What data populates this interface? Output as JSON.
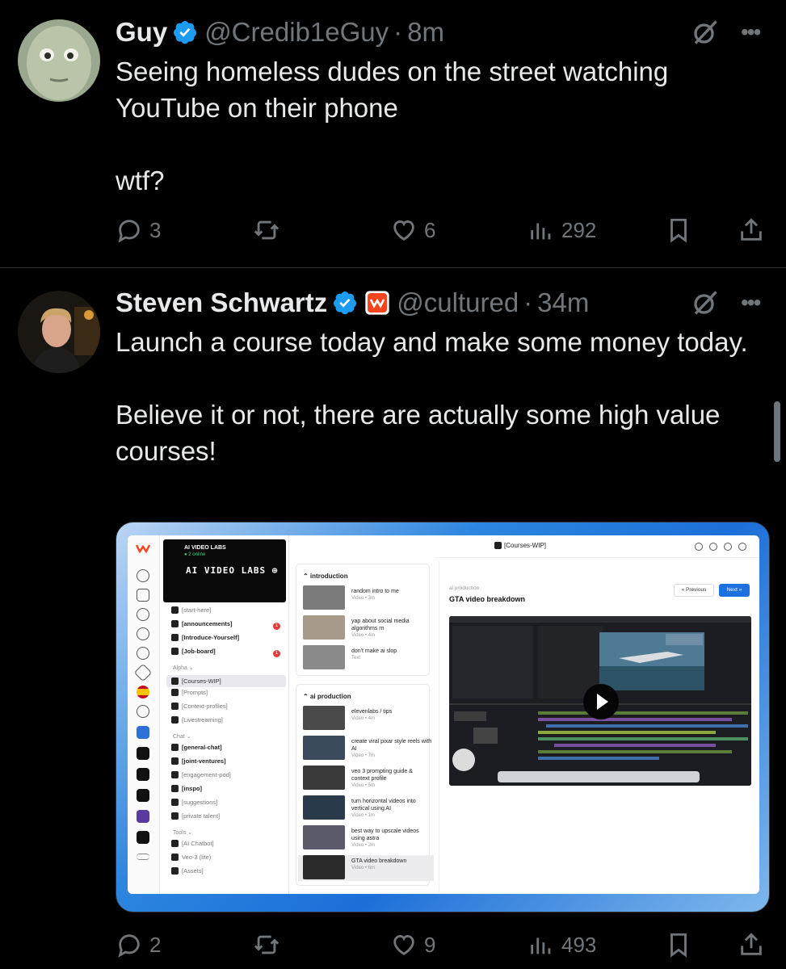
{
  "tweets": [
    {
      "name": "Guy",
      "handle": "@Credib1eGuy",
      "separator": "·",
      "time": "8m",
      "text": "Seeing homeless dudes on the street watching YouTube on their phone\n\nwtf?",
      "replies": "3",
      "retweets": "",
      "likes": "6",
      "views": "292"
    },
    {
      "name": "Steven Schwartz",
      "handle": "@cultured",
      "separator": "·",
      "time": "34m",
      "text": "Launch a course today and make some money today.\n\nBelieve it or not, there are actually some high value courses!",
      "replies": "2",
      "retweets": "",
      "likes": "9",
      "views": "493"
    }
  ],
  "colors": {
    "verified": "#1d9bf0",
    "muted": "#71767b",
    "text": "#e7e9ea",
    "affiliate": "#f5451f"
  },
  "more_glyph": "•••",
  "screenshot": {
    "server_name": "AI VIDEO LABS",
    "online": "● 2 online",
    "banner_text": "AI VIDEO LABS ⊕",
    "channels": [
      {
        "label": "[start-here]",
        "style": "muted"
      },
      {
        "label": "[announcements]",
        "style": "bold",
        "badge": "1"
      },
      {
        "label": "[Introduce-Yourself]",
        "style": "bold"
      },
      {
        "label": "[Job-board]",
        "style": "bold",
        "badge": "1"
      },
      {
        "label": "Alpha ⌄",
        "style": "section"
      },
      {
        "label": "[Courses-WIP]",
        "style": "selected"
      },
      {
        "label": "[Prompts]",
        "style": "muted"
      },
      {
        "label": "[Context-profiles]",
        "style": "muted"
      },
      {
        "label": "[Livestreaming]",
        "style": "muted"
      },
      {
        "label": "Chat ⌄",
        "style": "section"
      },
      {
        "label": "[general-chat]",
        "style": "bold"
      },
      {
        "label": "[joint-ventures]",
        "style": "bold"
      },
      {
        "label": "[engagement-pod]",
        "style": "muted"
      },
      {
        "label": "[inspo]",
        "style": "bold"
      },
      {
        "label": "[suggestions]",
        "style": "muted"
      },
      {
        "label": "[private talent]",
        "style": "muted"
      },
      {
        "label": "Tools ⌄",
        "style": "section"
      },
      {
        "label": "[AI Chatbot]",
        "style": "muted"
      },
      {
        "label": "Veo-3 (lite)",
        "style": "muted"
      },
      {
        "label": "[Assets]",
        "style": "muted"
      }
    ],
    "sections": [
      {
        "title": "⌃ introduction",
        "lessons": [
          {
            "title": "random intro to me",
            "meta": "Video • 3m"
          },
          {
            "title": "yap about social media algorithms rn",
            "meta": "Video • 4m"
          },
          {
            "title": "don't make ai slop",
            "meta": "Text"
          }
        ]
      },
      {
        "title": "⌃ ai production",
        "lessons": [
          {
            "title": "elevenlabs / tips",
            "meta": "Video • 4m"
          },
          {
            "title": "create viral pixar style reels with AI",
            "meta": "Video • 7m"
          },
          {
            "title": "veo 3 prompting guide & context profile",
            "meta": "Video • 5m"
          },
          {
            "title": "turn horizontal videos into vertical using AI",
            "meta": "Video • 1m"
          },
          {
            "title": "best way to upscale videos using astra",
            "meta": "Video • 2m"
          },
          {
            "title": "GTA video breakdown",
            "meta": "Video • 6m"
          }
        ]
      }
    ],
    "breadcrumb": "[Courses-WIP]",
    "subheading": "ai production",
    "lesson_title": "GTA video breakdown",
    "prev_label": "« Previous",
    "next_label": "Next »"
  }
}
